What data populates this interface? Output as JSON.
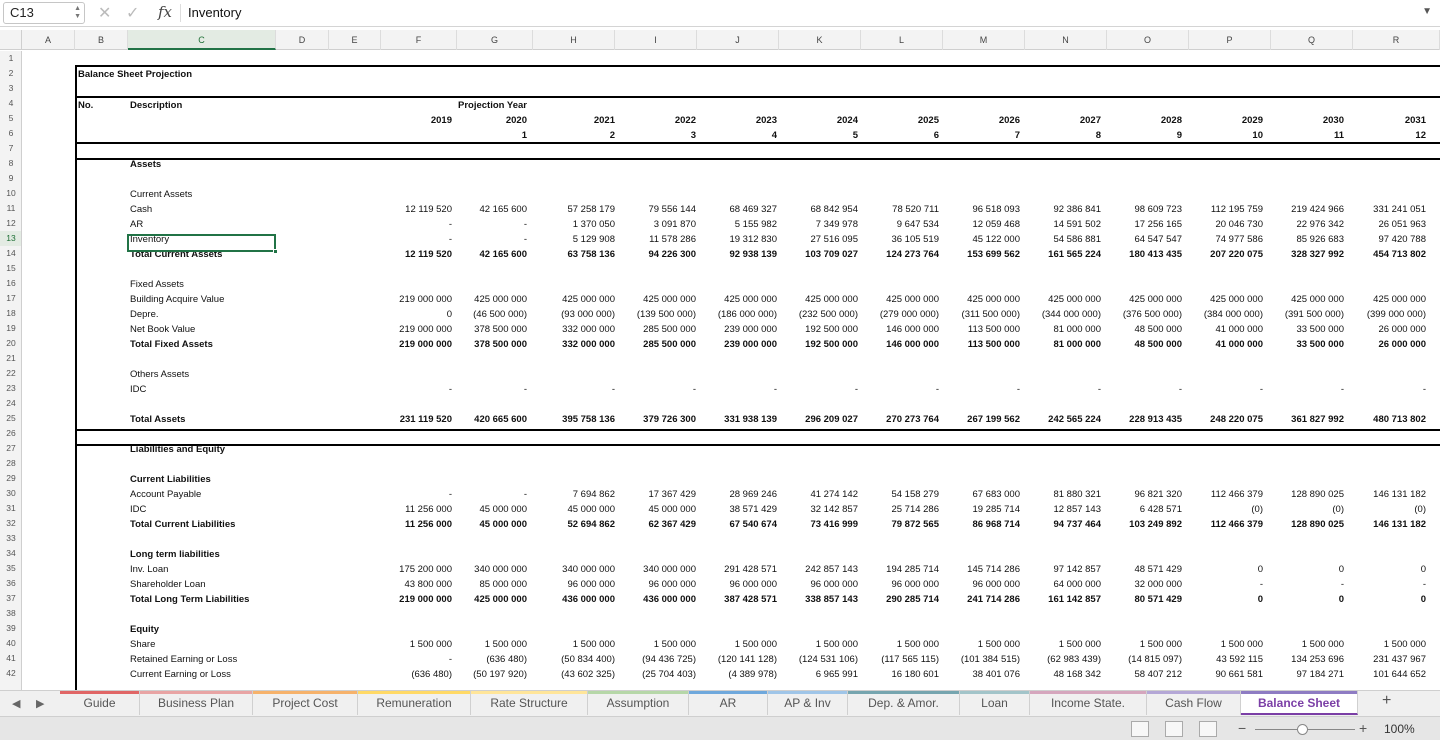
{
  "formula_bar": {
    "name_box": "C13",
    "fx": "fx",
    "value": "Inventory"
  },
  "columns": [
    "A",
    "B",
    "C",
    "D",
    "E",
    "F",
    "G",
    "H",
    "I",
    "J",
    "K",
    "L",
    "M",
    "N",
    "O",
    "P",
    "Q",
    "R"
  ],
  "row_numbers": [
    "1",
    "2",
    "3",
    "4",
    "5",
    "6",
    "7",
    "8",
    "9",
    "10",
    "11",
    "12",
    "13",
    "14",
    "15",
    "16",
    "17",
    "18",
    "19",
    "20",
    "21",
    "22",
    "23",
    "24",
    "25",
    "26",
    "27",
    "28",
    "29",
    "30",
    "31",
    "32",
    "33",
    "34",
    "35",
    "36",
    "37",
    "38",
    "39",
    "40",
    "41",
    "42"
  ],
  "sheet": {
    "title": "Balance Sheet Projection",
    "no_label": "No.",
    "description_label": "Description",
    "projection_year_label": "Projection Year",
    "years": [
      "2019",
      "2020",
      "2021",
      "2022",
      "2023",
      "2024",
      "2025",
      "2026",
      "2027",
      "2028",
      "2029",
      "2030",
      "2031"
    ],
    "periods": [
      "",
      "1",
      "2",
      "3",
      "4",
      "5",
      "6",
      "7",
      "8",
      "9",
      "10",
      "11",
      "12"
    ],
    "rows": [
      {
        "r": 8,
        "label": "Assets",
        "bold": true,
        "values": []
      },
      {
        "r": 10,
        "label": "Current Assets",
        "bold": false,
        "values": []
      },
      {
        "r": 11,
        "label": "Cash",
        "bold": false,
        "values": [
          "12 119 520",
          "42 165 600",
          "57 258 179",
          "79 556 144",
          "68 469 327",
          "68 842 954",
          "78 520 711",
          "96 518 093",
          "92 386 841",
          "98 609 723",
          "112 195 759",
          "219 424 966",
          "331 241 051"
        ]
      },
      {
        "r": 12,
        "label": "AR",
        "bold": false,
        "values": [
          "-",
          "-",
          "1 370 050",
          "3 091 870",
          "5 155 982",
          "7 349 978",
          "9 647 534",
          "12 059 468",
          "14 591 502",
          "17 256 165",
          "20 046 730",
          "22 976 342",
          "26 051 963"
        ]
      },
      {
        "r": 13,
        "label": "Inventory",
        "bold": false,
        "values": [
          "-",
          "-",
          "5 129 908",
          "11 578 286",
          "19 312 830",
          "27 516 095",
          "36 105 519",
          "45 122 000",
          "54 586 881",
          "64 547 547",
          "74 977 586",
          "85 926 683",
          "97 420 788"
        ]
      },
      {
        "r": 14,
        "label": "Total Current Assets",
        "bold": true,
        "values": [
          "12 119 520",
          "42 165 600",
          "63 758 136",
          "94 226 300",
          "92 938 139",
          "103 709 027",
          "124 273 764",
          "153 699 562",
          "161 565 224",
          "180 413 435",
          "207 220 075",
          "328 327 992",
          "454 713 802"
        ]
      },
      {
        "r": 16,
        "label": "Fixed Assets",
        "bold": false,
        "values": []
      },
      {
        "r": 17,
        "label": "Building Acquire Value",
        "bold": false,
        "values": [
          "219 000 000",
          "425 000 000",
          "425 000 000",
          "425 000 000",
          "425 000 000",
          "425 000 000",
          "425 000 000",
          "425 000 000",
          "425 000 000",
          "425 000 000",
          "425 000 000",
          "425 000 000",
          "425 000 000"
        ]
      },
      {
        "r": 18,
        "label": "Depre.",
        "bold": false,
        "values": [
          "0",
          "(46 500 000)",
          "(93 000 000)",
          "(139 500 000)",
          "(186 000 000)",
          "(232 500 000)",
          "(279 000 000)",
          "(311 500 000)",
          "(344 000 000)",
          "(376 500 000)",
          "(384 000 000)",
          "(391 500 000)",
          "(399 000 000)"
        ]
      },
      {
        "r": 19,
        "label": "Net Book Value",
        "bold": false,
        "values": [
          "219 000 000",
          "378 500 000",
          "332 000 000",
          "285 500 000",
          "239 000 000",
          "192 500 000",
          "146 000 000",
          "113 500 000",
          "81 000 000",
          "48 500 000",
          "41 000 000",
          "33 500 000",
          "26 000 000"
        ]
      },
      {
        "r": 20,
        "label": "Total Fixed Assets",
        "bold": true,
        "values": [
          "219 000 000",
          "378 500 000",
          "332 000 000",
          "285 500 000",
          "239 000 000",
          "192 500 000",
          "146 000 000",
          "113 500 000",
          "81 000 000",
          "48 500 000",
          "41 000 000",
          "33 500 000",
          "26 000 000"
        ]
      },
      {
        "r": 22,
        "label": "Others Assets",
        "bold": false,
        "values": []
      },
      {
        "r": 23,
        "label": "IDC",
        "bold": false,
        "values": [
          "-",
          "-",
          "-",
          "-",
          "-",
          "-",
          "-",
          "-",
          "-",
          "-",
          "-",
          "-",
          "-"
        ]
      },
      {
        "r": 25,
        "label": "Total Assets",
        "bold": true,
        "values": [
          "231 119 520",
          "420 665 600",
          "395 758 136",
          "379 726 300",
          "331 938 139",
          "296 209 027",
          "270 273 764",
          "267 199 562",
          "242 565 224",
          "228 913 435",
          "248 220 075",
          "361 827 992",
          "480 713 802"
        ]
      },
      {
        "r": 27,
        "label": "Liabilities and Equity",
        "bold": true,
        "values": []
      },
      {
        "r": 29,
        "label": "Current Liabilities",
        "bold": true,
        "values": []
      },
      {
        "r": 30,
        "label": "Account Payable",
        "bold": false,
        "values": [
          "-",
          "-",
          "7 694 862",
          "17 367 429",
          "28 969 246",
          "41 274 142",
          "54 158 279",
          "67 683 000",
          "81 880 321",
          "96 821 320",
          "112 466 379",
          "128 890 025",
          "146 131 182"
        ]
      },
      {
        "r": 31,
        "label": "IDC",
        "bold": false,
        "values": [
          "11 256 000",
          "45 000 000",
          "45 000 000",
          "45 000 000",
          "38 571 429",
          "32 142 857",
          "25 714 286",
          "19 285 714",
          "12 857 143",
          "6 428 571",
          "(0)",
          "(0)",
          "(0)"
        ]
      },
      {
        "r": 32,
        "label": "Total Current Liabilities",
        "bold": true,
        "values": [
          "11 256 000",
          "45 000 000",
          "52 694 862",
          "62 367 429",
          "67 540 674",
          "73 416 999",
          "79 872 565",
          "86 968 714",
          "94 737 464",
          "103 249 892",
          "112 466 379",
          "128 890 025",
          "146 131 182"
        ]
      },
      {
        "r": 34,
        "label": "Long term liabilities",
        "bold": true,
        "values": []
      },
      {
        "r": 35,
        "label": "Inv. Loan",
        "bold": false,
        "values": [
          "175 200 000",
          "340 000 000",
          "340 000 000",
          "340 000 000",
          "291 428 571",
          "242 857 143",
          "194 285 714",
          "145 714 286",
          "97 142 857",
          "48 571 429",
          "0",
          "0",
          "0"
        ]
      },
      {
        "r": 36,
        "label": "Shareholder Loan",
        "bold": false,
        "values": [
          "43 800 000",
          "85 000 000",
          "96 000 000",
          "96 000 000",
          "96 000 000",
          "96 000 000",
          "96 000 000",
          "96 000 000",
          "64 000 000",
          "32 000 000",
          "-",
          "-",
          "-"
        ]
      },
      {
        "r": 37,
        "label": "Total Long Term Liabilities",
        "bold": true,
        "values": [
          "219 000 000",
          "425 000 000",
          "436 000 000",
          "436 000 000",
          "387 428 571",
          "338 857 143",
          "290 285 714",
          "241 714 286",
          "161 142 857",
          "80 571 429",
          "0",
          "0",
          "0"
        ]
      },
      {
        "r": 39,
        "label": "Equity",
        "bold": true,
        "values": []
      },
      {
        "r": 40,
        "label": "Share",
        "bold": false,
        "values": [
          "1 500 000",
          "1 500 000",
          "1 500 000",
          "1 500 000",
          "1 500 000",
          "1 500 000",
          "1 500 000",
          "1 500 000",
          "1 500 000",
          "1 500 000",
          "1 500 000",
          "1 500 000",
          "1 500 000"
        ]
      },
      {
        "r": 41,
        "label": "Retained Earning or Loss",
        "bold": false,
        "values": [
          "-",
          "(636 480)",
          "(50 834 400)",
          "(94 436 725)",
          "(120 141 128)",
          "(124 531 106)",
          "(117 565 115)",
          "(101 384 515)",
          "(62 983 439)",
          "(14 815 097)",
          "43 592 115",
          "134 253 696",
          "231 437 967"
        ]
      },
      {
        "r": 42,
        "label": "Current Earning or Loss",
        "bold": false,
        "values": [
          "(636 480)",
          "(50 197 920)",
          "(43 602 325)",
          "(25 704 403)",
          "(4 389 978)",
          "6 965 991",
          "16 180 601",
          "38 401 076",
          "48 168 342",
          "58 407 212",
          "90 661 581",
          "97 184 271",
          "101 644 652"
        ]
      }
    ]
  },
  "tabs": [
    {
      "label": "Guide",
      "color": "#e06666"
    },
    {
      "label": "Business Plan",
      "color": "#e8a4a4"
    },
    {
      "label": "Project Cost",
      "color": "#f6b26b"
    },
    {
      "label": "Remuneration",
      "color": "#ffd966"
    },
    {
      "label": "Rate Structure",
      "color": "#ffe599"
    },
    {
      "label": "Assumption",
      "color": "#b6d7a8"
    },
    {
      "label": "AR",
      "color": "#6fa8dc"
    },
    {
      "label": "AP & Inv",
      "color": "#9fc5e8"
    },
    {
      "label": "Dep. & Amor.",
      "color": "#76a5af"
    },
    {
      "label": "Loan",
      "color": "#a2c4c9"
    },
    {
      "label": "Income State.",
      "color": "#d5a6bd"
    },
    {
      "label": "Cash Flow",
      "color": "#b4a7d6"
    },
    {
      "label": "Balance Sheet",
      "color": "#8e7cc3"
    }
  ],
  "active_tab": "Balance Sheet",
  "status": {
    "zoom": "100%"
  }
}
